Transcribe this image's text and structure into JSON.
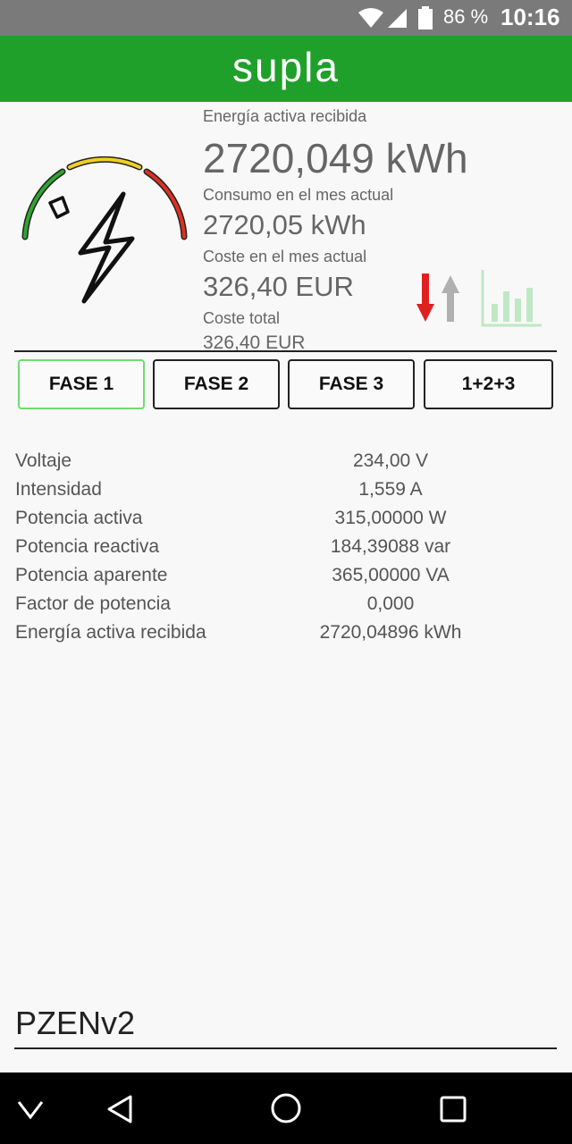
{
  "statusbar": {
    "battery": "86 %",
    "time": "10:16"
  },
  "header": {
    "logo": "supla"
  },
  "summary": {
    "energy_label": "Energía activa recibida",
    "energy_value": "2720,049 kWh",
    "month_consumption_label": "Consumo en el mes actual",
    "month_consumption_value": "2720,05 kWh",
    "month_cost_label": "Coste en el mes actual",
    "month_cost_value": "326,40 EUR",
    "total_cost_label": "Coste total",
    "total_cost_value": "326,40 EUR"
  },
  "tabs": [
    "FASE 1",
    "FASE 2",
    "FASE 3",
    "1+2+3"
  ],
  "active_tab": "FASE 1",
  "measurements": [
    {
      "label": "Voltaje",
      "value": "234,00 V"
    },
    {
      "label": "Intensidad",
      "value": "1,559 A"
    },
    {
      "label": "Potencia activa",
      "value": "315,00000 W"
    },
    {
      "label": "Potencia reactiva",
      "value": "184,39088 var"
    },
    {
      "label": "Potencia aparente",
      "value": "365,00000 VA"
    },
    {
      "label": "Factor de potencia",
      "value": "0,000"
    },
    {
      "label": "Energía activa recibida",
      "value": "2720,04896 kWh"
    }
  ],
  "device_name": "PZENv2",
  "icons": {
    "meter": "electricity-meter-icon",
    "arrows": "direction-arrows-icon",
    "chart": "bar-chart-icon",
    "nav_back": "back-triangle-icon",
    "nav_home": "home-circle-icon",
    "nav_recents": "recents-square-icon",
    "nav_collapse": "chevron-down-icon"
  },
  "colors": {
    "brand_green": "#1fa02a",
    "active_tab_border": "#6fdc6f",
    "arrow_down": "#e02020",
    "arrow_up": "#b0b0b0"
  }
}
